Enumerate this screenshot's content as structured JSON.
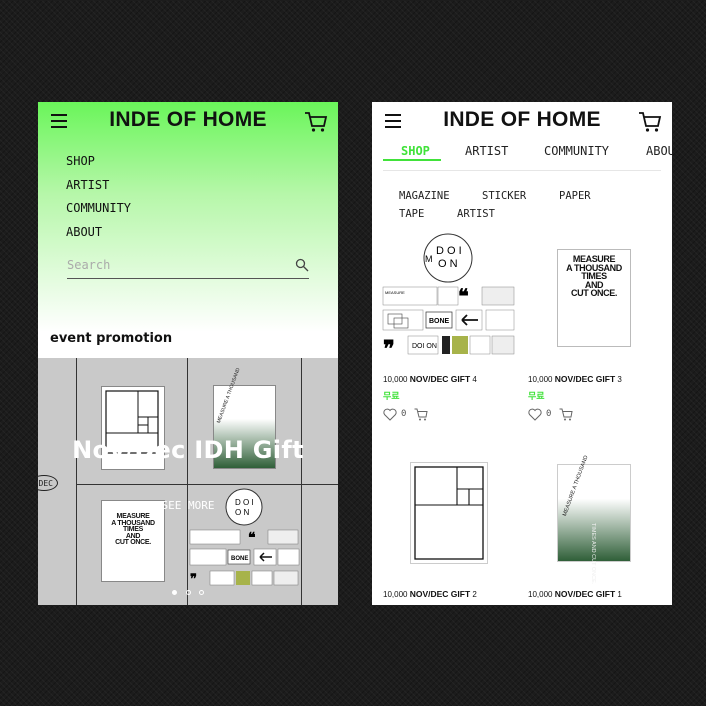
{
  "brand": "INDE OF HOME",
  "left_screen": {
    "menu": [
      "SHOP",
      "ARTIST",
      "COMMUNITY",
      "ABOUT"
    ],
    "search_placeholder": "Search",
    "section_title": "event promotion",
    "banner": {
      "title": "Nov/Dec IDH Gift",
      "cta": "SEE MORE",
      "dots": 3,
      "active_dot": 1
    }
  },
  "right_screen": {
    "tabs": [
      "SHOP",
      "ARTIST",
      "COMMUNITY",
      "ABOUT"
    ],
    "active_tab": "SHOP",
    "subcategories": [
      "MAGAZINE",
      "STICKER",
      "PAPER",
      "TAPE",
      "ARTIST"
    ],
    "products": [
      {
        "name_prefix": "10,000",
        "name": "NOV/DEC GIFT",
        "name_suffix": "4",
        "price": "무료",
        "likes": "0"
      },
      {
        "name_prefix": "10,000",
        "name": "NOV/DEC GIFT",
        "name_suffix": "3",
        "price": "무료",
        "likes": "0"
      },
      {
        "name_prefix": "10,000",
        "name": "NOV/DEC GIFT",
        "name_suffix": "2"
      },
      {
        "name_prefix": "10,000",
        "name": "NOV/DEC GIFT",
        "name_suffix": "1"
      }
    ]
  },
  "poster_texts": {
    "measure": [
      "MEASURE",
      "A THOUSAND",
      "TIMES",
      "AND",
      "CUT ONCE."
    ],
    "measure_rotated": "MEASURE A THOUSAND",
    "measure_side": "TIMES AND CUT ONCE.",
    "doi_letters": [
      "M",
      "D",
      "O",
      "I",
      "O",
      "N"
    ],
    "bone": "BONE",
    "dec_badge": "DEC"
  },
  "colors": {
    "accent_green": "#41e23a",
    "gradient_top": "#6af55a",
    "banner_gray": "#c9c9c9"
  }
}
